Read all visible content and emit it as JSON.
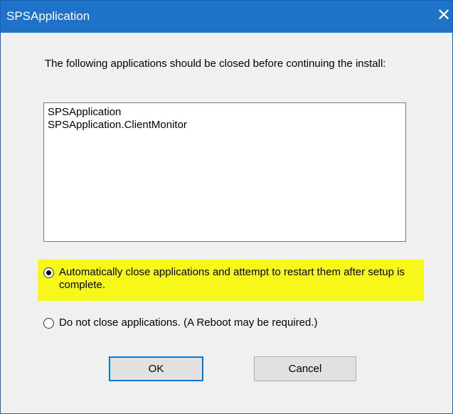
{
  "window": {
    "title": "SPSApplication",
    "close_glyph": "✕"
  },
  "message": "The following applications should be closed before continuing the install:",
  "applications": [
    "SPSApplication",
    "SPSApplication.ClientMonitor"
  ],
  "options": {
    "auto_close": {
      "label": "Automatically close applications and attempt to restart them after setup is complete.",
      "selected": true
    },
    "do_not_close": {
      "label": "Do not close applications. (A Reboot may be required.)",
      "selected": false
    }
  },
  "buttons": {
    "ok": "OK",
    "cancel": "Cancel"
  },
  "colors": {
    "titlebar": "#1e73c8",
    "highlight": "#f7f71a",
    "dialog_background": "#f0f0f0",
    "default_button_border": "#0078d7"
  },
  "icons": {
    "close": "close-icon"
  }
}
